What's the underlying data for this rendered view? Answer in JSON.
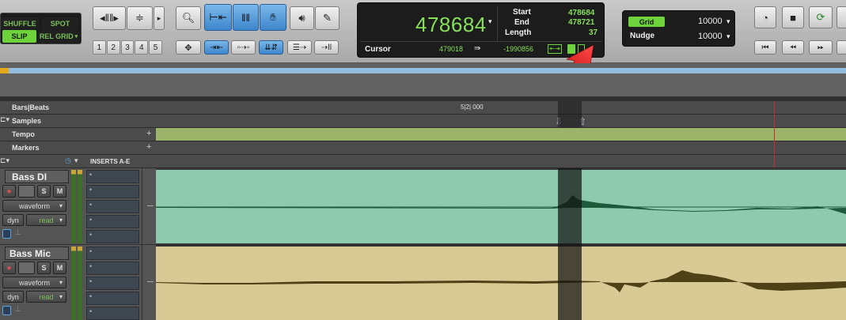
{
  "modes": {
    "shuffle": "SHUFFLE",
    "spot": "SPOT",
    "slip": "SLIP",
    "relgrid": "REL GRID"
  },
  "zoom_presets": [
    "1",
    "2",
    "3",
    "4",
    "5"
  ],
  "counter": {
    "main_value": "478684",
    "start_label": "Start",
    "start_value": "478684",
    "end_label": "End",
    "end_value": "478721",
    "length_label": "Length",
    "length_value": "37",
    "cursor_label": "Cursor",
    "cursor_value": "479018",
    "cursor_offset": "-1990856"
  },
  "grid": {
    "label": "Grid",
    "value": "10000"
  },
  "nudge": {
    "label": "Nudge",
    "value": "10000"
  },
  "rulers": {
    "bars_beats": "Bars|Beats",
    "bar_marker": "5|2| 000",
    "samples": "Samples",
    "tempo": "Tempo",
    "markers": "Markers"
  },
  "inserts_header": "INSERTS A-E",
  "tracks": [
    {
      "name": "Bass DI",
      "solo": "S",
      "mute": "M",
      "view": "waveform",
      "automation": "dyn",
      "auto_mode": "read"
    },
    {
      "name": "Bass Mic",
      "solo": "S",
      "mute": "M",
      "view": "waveform",
      "automation": "dyn",
      "auto_mode": "read"
    }
  ],
  "colors": {
    "track1_clip": "#8ecbae",
    "track1_wave": "#1d5a3c",
    "track2_clip": "#d8c995",
    "track2_wave": "#4e4116",
    "tempo_ruler": "#9cb36a",
    "accent_green": "#86e05a",
    "playhead": "#cc2b2b"
  }
}
